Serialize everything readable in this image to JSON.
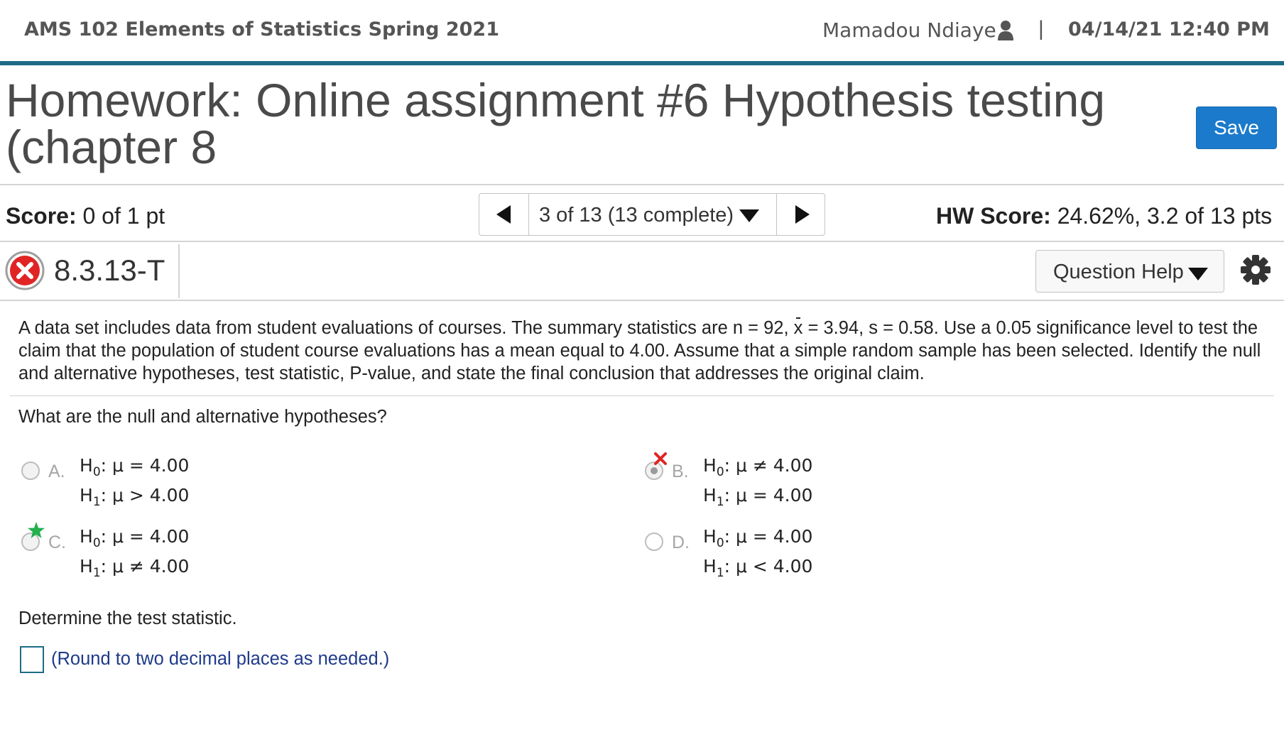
{
  "header": {
    "course": "AMS 102 Elements of Statistics Spring 2021",
    "user": "Mamadou Ndiaye",
    "separator": "|",
    "datetime": "04/14/21 12:40 PM"
  },
  "title": {
    "text": "Homework: Online assignment #6 Hypothesis testing (chapter 8",
    "save_label": "Save"
  },
  "scorebar": {
    "score_label": "Score:",
    "score_value": "0 of 1 pt",
    "pager_label": "3 of 13 (13 complete)",
    "hw_label": "HW Score:",
    "hw_value": "24.62%, 3.2 of 13 pts"
  },
  "question_bar": {
    "id": "8.3.13-T",
    "status": "incorrect",
    "help_label": "Question Help"
  },
  "problem": {
    "p1": "A data set includes data from student evaluations of courses. The summary statistics are n = 92, ",
    "xbar": "x",
    "p2": " = 3.94, s = 0.58. Use a 0.05 significance level to test the claim that the population of student course evaluations has a mean equal to 4.00. Assume that a simple random sample has been selected. Identify the null and alternative hypotheses, test statistic, P-value, and state the final conclusion that addresses the original claim."
  },
  "question1": {
    "prompt": "What are the null and alternative hypotheses?",
    "options": [
      {
        "letter": "A.",
        "h0": "μ = 4.00",
        "h1": "μ > 4.00",
        "state": "unselected"
      },
      {
        "letter": "B.",
        "h0": "μ ≠ 4.00",
        "h1": "μ = 4.00",
        "state": "selected-wrong"
      },
      {
        "letter": "C.",
        "h0": "μ = 4.00",
        "h1": "μ ≠ 4.00",
        "state": "correct-answer"
      },
      {
        "letter": "D.",
        "h0": "μ = 4.00",
        "h1": "μ < 4.00",
        "state": "unselected"
      }
    ]
  },
  "question2": {
    "prompt": "Determine the test statistic.",
    "answer_value": "",
    "hint": "(Round to two decimal places as needed.)"
  },
  "colors": {
    "accent": "#1d6b86",
    "save_button": "#1b7acb",
    "incorrect": "#e02424",
    "correct_star": "#22b14c",
    "hint_text": "#1e3a8a"
  }
}
